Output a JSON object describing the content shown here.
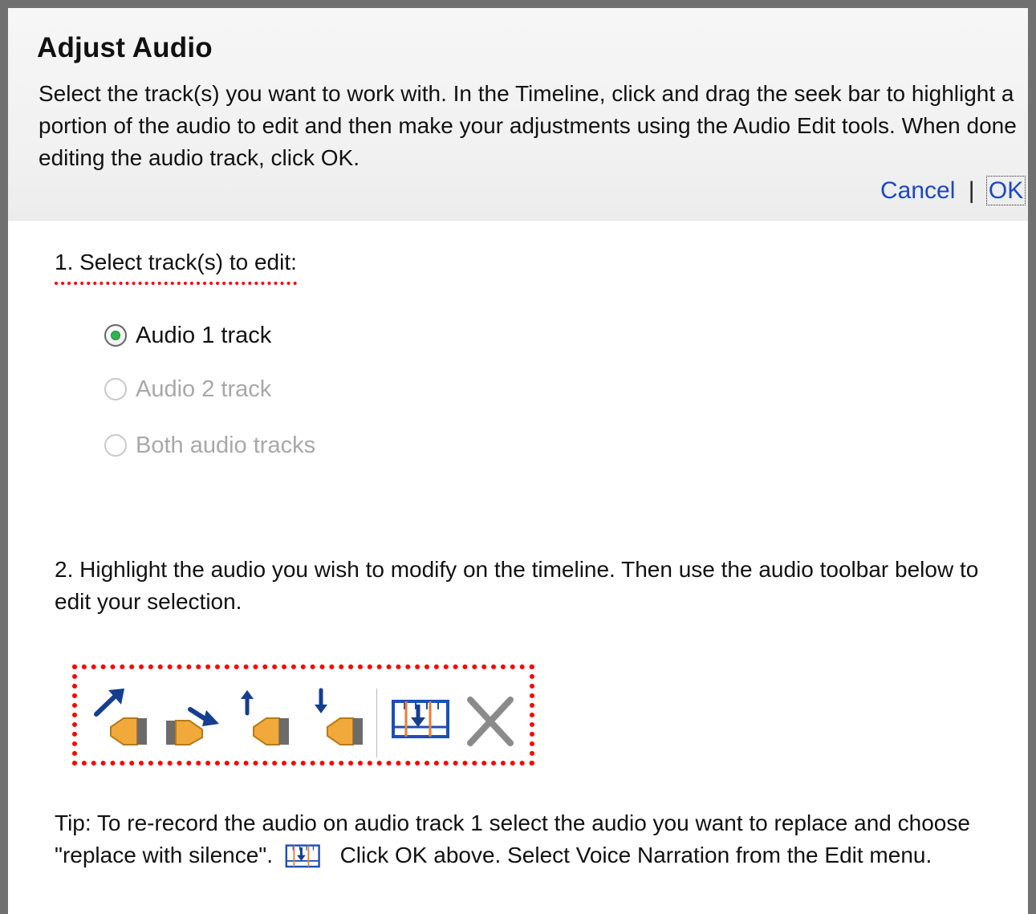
{
  "dialog": {
    "title": "Adjust Audio",
    "intro": "Select the track(s) you want to work with. In the Timeline, click and drag the seek bar to highlight a portion of the audio to edit and then make your adjustments using the Audio Edit tools. When done editing the audio track, click OK.",
    "actions": {
      "cancel_label": "Cancel",
      "separator": "|",
      "ok_label": "OK"
    }
  },
  "step1": {
    "label": "1. Select track(s) to edit:",
    "options": [
      {
        "label": "Audio 1 track",
        "selected": true,
        "enabled": true
      },
      {
        "label": "Audio 2 track",
        "selected": false,
        "enabled": false
      },
      {
        "label": "Both audio tracks",
        "selected": false,
        "enabled": false
      }
    ]
  },
  "step2": {
    "text": "2. Highlight the audio you wish to modify on the timeline.  Then use the audio toolbar below to edit your selection."
  },
  "toolbar": {
    "icons": [
      "fade-in-icon",
      "fade-out-icon",
      "volume-up-icon",
      "volume-down-icon",
      "replace-with-silence-icon",
      "delete-icon"
    ]
  },
  "tip": {
    "text_before_icon": "Tip:  To re-record the audio on audio track 1 select the audio you want to replace and choose \"replace with silence\".",
    "text_after_icon": "Click OK above.  Select Voice Narration from the Edit menu."
  },
  "colors": {
    "link": "#1947c8",
    "highlight_border": "#ff0000",
    "radio_selected": "#33b24f",
    "disabled_text": "#a8a8a8",
    "speaker": "#f2a93b",
    "arrow": "#163e8f"
  }
}
